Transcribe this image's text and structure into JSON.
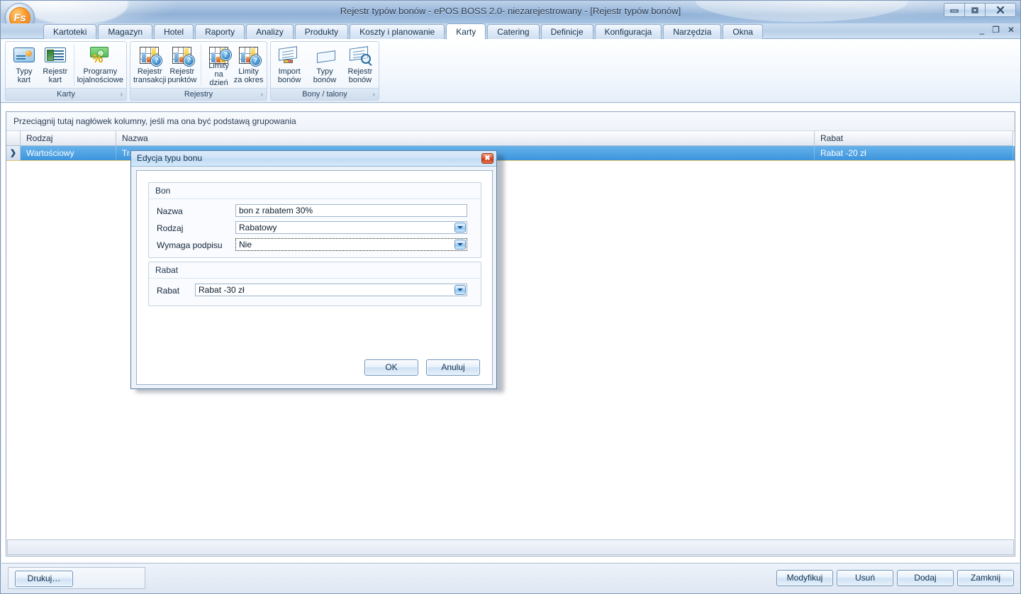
{
  "window": {
    "title": "Rejestr typów bonów - ePOS BOSS 2.0- niezarejestrowany - [Rejestr typów bonów]",
    "logo_text": "Fs",
    "buttons": {
      "minimize": "minimize-icon",
      "restore": "restore-icon",
      "close": "close-icon"
    },
    "mdi_buttons": {
      "minimize": "_",
      "restore": "❐",
      "close": "✕"
    }
  },
  "tabs": [
    {
      "label": "Kartoteki",
      "active": false
    },
    {
      "label": "Magazyn",
      "active": false
    },
    {
      "label": "Hotel",
      "active": false
    },
    {
      "label": "Raporty",
      "active": false
    },
    {
      "label": "Analizy",
      "active": false
    },
    {
      "label": "Produkty",
      "active": false
    },
    {
      "label": "Koszty i planowanie",
      "active": false
    },
    {
      "label": "Karty",
      "active": true
    },
    {
      "label": "Catering",
      "active": false
    },
    {
      "label": "Definicje",
      "active": false
    },
    {
      "label": "Konfiguracja",
      "active": false
    },
    {
      "label": "Narzędzia",
      "active": false
    },
    {
      "label": "Okna",
      "active": false
    }
  ],
  "ribbon": {
    "groups": [
      {
        "caption": "Karty",
        "expander": "›",
        "items": [
          {
            "label": "Typy kart",
            "icon": "card-icon"
          },
          {
            "label": "Rejestr\nkart",
            "icon": "id-card-icon"
          },
          {
            "label": "Programy\nlojalnościowe",
            "icon": "loyalty-money-percent-icon"
          }
        ]
      },
      {
        "caption": "Rejestry",
        "expander": "›",
        "items": [
          {
            "label": "Rejestr\ntransakcji",
            "icon": "chart-question-icon"
          },
          {
            "label": "Rejestr\npunktów",
            "icon": "chart-question-icon"
          },
          {
            "label": "Limity\nna dzień",
            "icon": "chart-question-icon"
          },
          {
            "label": "Limity\nza okres",
            "icon": "chart-question-icon"
          }
        ]
      },
      {
        "caption": "Bony / talony",
        "expander": "›",
        "items": [
          {
            "label": "Import\nbonów",
            "icon": "import-voucher-icon"
          },
          {
            "label": "Typy bonów",
            "icon": "voucher-types-icon"
          },
          {
            "label": "Rejestr\nbonów",
            "icon": "voucher-search-icon"
          }
        ]
      }
    ]
  },
  "grid": {
    "group_hint": "Przeciągnij tutaj nagłówek kolumny, jeśli ma ona być podstawą grupowania",
    "columns": [
      "Rodzaj",
      "Nazwa",
      "Rabat"
    ],
    "row_indicator": "❯",
    "rows": [
      {
        "rodzaj": "Wartościowy",
        "nazwa": "Tra",
        "rabat": "Rabat -20 zł"
      }
    ]
  },
  "bottom": {
    "print_label": "Drukuj…",
    "actions": [
      "Modyfikuj",
      "Usuń",
      "Dodaj",
      "Zamknij"
    ]
  },
  "dialog": {
    "title": "Edycja typu bonu",
    "close_glyph": "✖",
    "groups": {
      "bon": {
        "title": "Bon",
        "fields": [
          {
            "label": "Nazwa",
            "value": "bon z rabatem 30%",
            "type": "text"
          },
          {
            "label": "Rodzaj",
            "value": "Rabatowy",
            "type": "combo"
          },
          {
            "label": "Wymaga podpisu",
            "value": "Nie",
            "type": "combo",
            "focused": true
          }
        ]
      },
      "rabat": {
        "title": "Rabat",
        "fields": [
          {
            "label": "Rabat",
            "value": "Rabat -30 zł",
            "type": "combo"
          }
        ]
      }
    },
    "buttons": {
      "ok": "OK",
      "cancel": "Anuluj"
    }
  }
}
